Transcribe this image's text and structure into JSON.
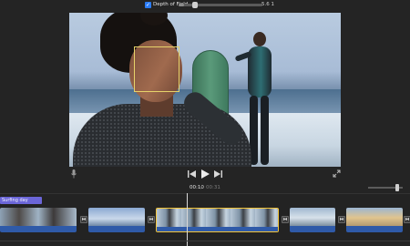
{
  "depth_of_field": {
    "checked": true,
    "label": "Depth of Field",
    "slider_fraction": 0.06,
    "value": "5.6 1"
  },
  "viewer": {
    "has_focus_box": true
  },
  "transport": {
    "icons": [
      "microphone-icon",
      "skip-back-icon",
      "play-icon",
      "skip-forward-icon",
      "expand-icon"
    ]
  },
  "timecode": {
    "current": "00:10",
    "separator": "/",
    "total": "00:31"
  },
  "timeline": {
    "title_clip": "Surfing day",
    "zoom_fraction": 0.85,
    "clips": [
      {
        "name": "clip-1",
        "selected": false
      },
      {
        "name": "clip-2",
        "selected": false
      },
      {
        "name": "clip-3",
        "selected": true
      },
      {
        "name": "clip-4",
        "selected": false
      },
      {
        "name": "clip-5",
        "selected": false
      }
    ]
  },
  "colors": {
    "accent": "#2b7cf6",
    "selection": "#f3c53a",
    "title_clip": "#6b66d8",
    "audio": "#2f5aa8",
    "focus": "#e7d36a"
  }
}
